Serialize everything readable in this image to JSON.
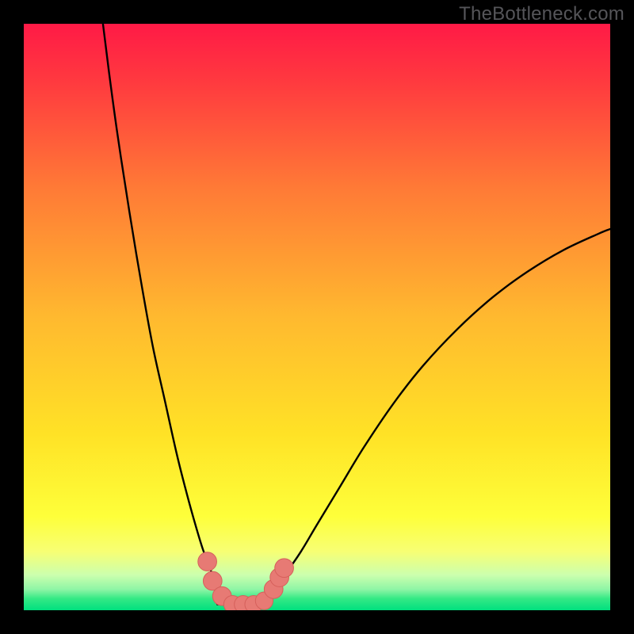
{
  "watermark": "TheBottleneck.com",
  "colors": {
    "frame": "#000000",
    "watermark": "#555559",
    "curve": "#000000",
    "markers_fill": "#e77a74",
    "markers_stroke": "#d6605b",
    "grad_top": "#ff1a46",
    "grad_mid": "#ffe000",
    "grad_yellow_band": "#f8fe7a",
    "grad_green": "#00e87a"
  },
  "chart_data": {
    "type": "line",
    "title": "",
    "xlabel": "",
    "ylabel": "",
    "xlim": [
      0,
      100
    ],
    "ylim": [
      0,
      100
    ],
    "left_curve": {
      "x": [
        13.5,
        14.5,
        16,
        18,
        20,
        22,
        24,
        26,
        27.5,
        29,
        30.5,
        32,
        33.5,
        35
      ],
      "y": [
        100,
        92,
        81,
        68,
        56,
        45,
        36,
        27,
        21,
        15.5,
        10.5,
        6.5,
        3.2,
        1.2
      ]
    },
    "right_curve": {
      "x": [
        40,
        42,
        44,
        47,
        50,
        54,
        58,
        63,
        68,
        74,
        80,
        86,
        92,
        98,
        100
      ],
      "y": [
        1.2,
        3.0,
        5.4,
        9.6,
        14.6,
        21.2,
        27.8,
        35.2,
        41.6,
        48.0,
        53.4,
        57.8,
        61.4,
        64.2,
        65.0
      ]
    },
    "flat_region": {
      "x0": 33.0,
      "x1": 42.0,
      "y": 1.0
    },
    "markers": [
      {
        "x": 31.3,
        "y": 8.3,
        "r": 1.6
      },
      {
        "x": 32.2,
        "y": 5.0,
        "r": 1.6
      },
      {
        "x": 33.8,
        "y": 2.4,
        "r": 1.6
      },
      {
        "x": 35.6,
        "y": 1.0,
        "r": 1.5
      },
      {
        "x": 37.4,
        "y": 1.0,
        "r": 1.5
      },
      {
        "x": 39.2,
        "y": 1.0,
        "r": 1.5
      },
      {
        "x": 41.0,
        "y": 1.6,
        "r": 1.5
      },
      {
        "x": 42.6,
        "y": 3.6,
        "r": 1.6
      },
      {
        "x": 43.6,
        "y": 5.6,
        "r": 1.6
      },
      {
        "x": 44.4,
        "y": 7.2,
        "r": 1.6
      }
    ]
  }
}
